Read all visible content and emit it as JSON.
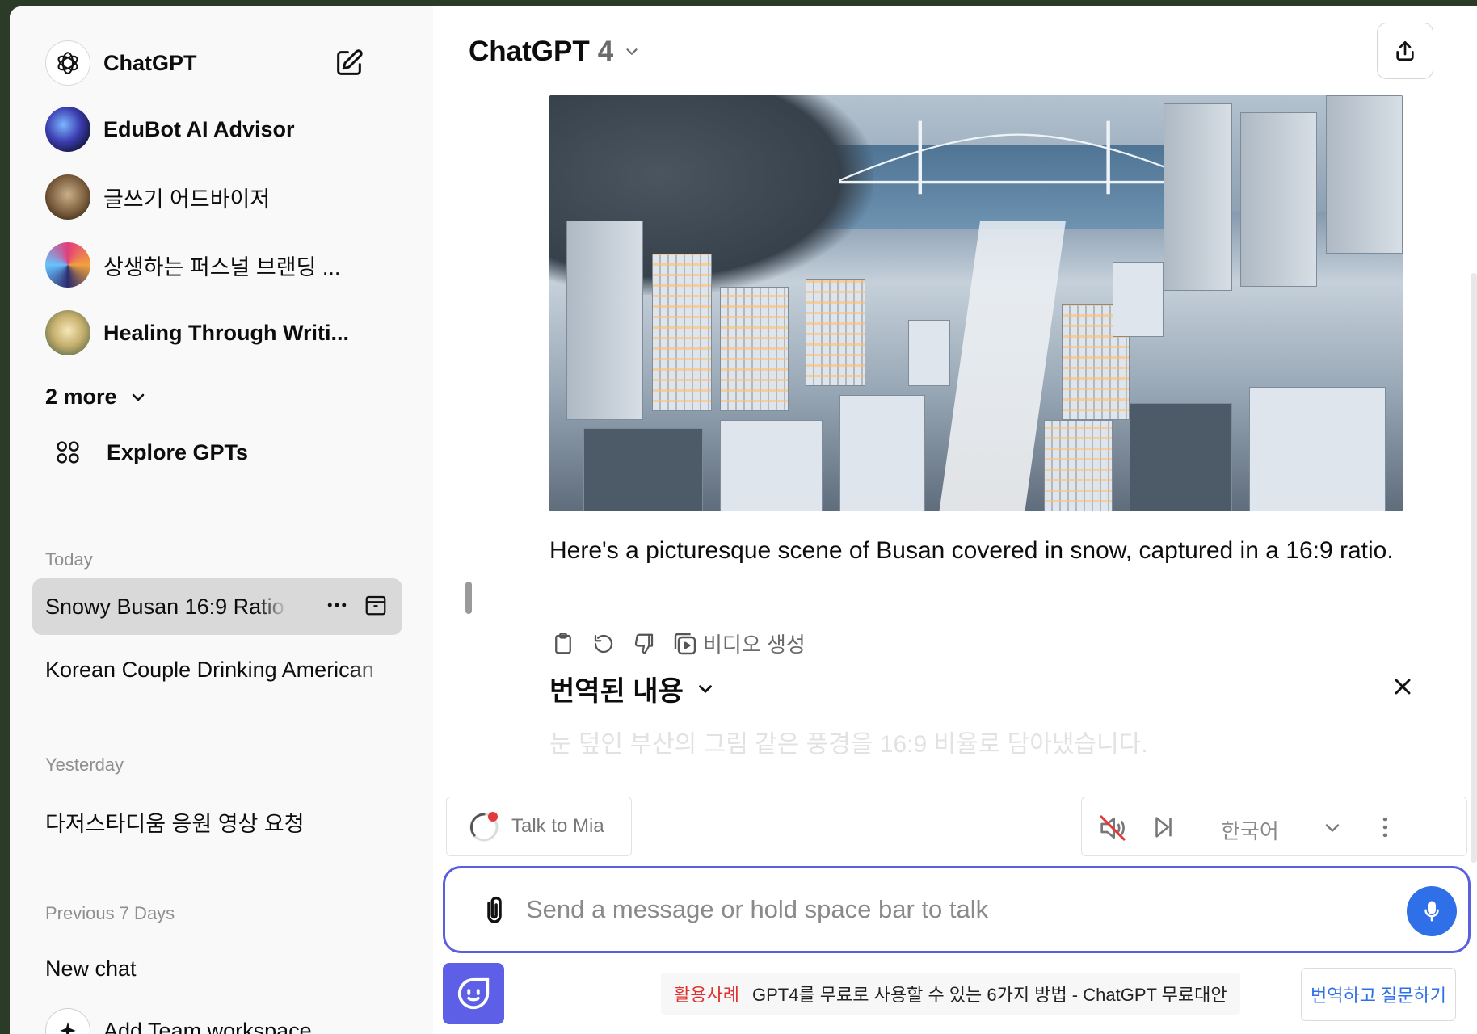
{
  "sidebar": {
    "app_name": "ChatGPT",
    "gpts": [
      {
        "name": "EduBot AI Advisor"
      },
      {
        "name": "글쓰기 어드바이저"
      },
      {
        "name": "상생하는 퍼스널 브랜딩 ..."
      },
      {
        "name": "Healing Through Writi..."
      }
    ],
    "more_label": "2 more",
    "explore_label": "Explore GPTs",
    "sections": {
      "today": "Today",
      "yesterday": "Yesterday",
      "previous_7_days": "Previous 7 Days"
    },
    "chats_today": [
      "Snowy Busan 16:9 Ratio",
      "Korean Couple Drinking American"
    ],
    "chats_yesterday": [
      "다저스타디움 응원 영상 요청"
    ],
    "chats_previous": [
      "New chat"
    ],
    "team_workspace_label": "Add Team workspace"
  },
  "header": {
    "model_name": "ChatGPT",
    "model_version": "4"
  },
  "message": {
    "text": "Here's a picturesque scene of Busan covered in snow, captured in a 16:9 ratio.",
    "video_label": "비디오 생성"
  },
  "translation": {
    "title": "번역된 내용",
    "text": "눈 덮인 부산의 그림 같은 풍경을 16:9 비율로 담아냈습니다."
  },
  "toolbar": {
    "talk_label": "Talk to Mia",
    "language": "한국어"
  },
  "composer": {
    "placeholder": "Send a message or hold space bar to talk"
  },
  "footer": {
    "promo_tag": "활용사례",
    "promo_text": "GPT4를 무료로 사용할 수 있는 6가지 방법 - ChatGPT 무료대안",
    "translate_ask_label": "번역하고 질문하기"
  },
  "colors": {
    "accent": "#5a5fe0",
    "mic": "#2f6fe8",
    "promo_tag": "#e03131",
    "active_chat_bg": "#d9d9d9"
  }
}
